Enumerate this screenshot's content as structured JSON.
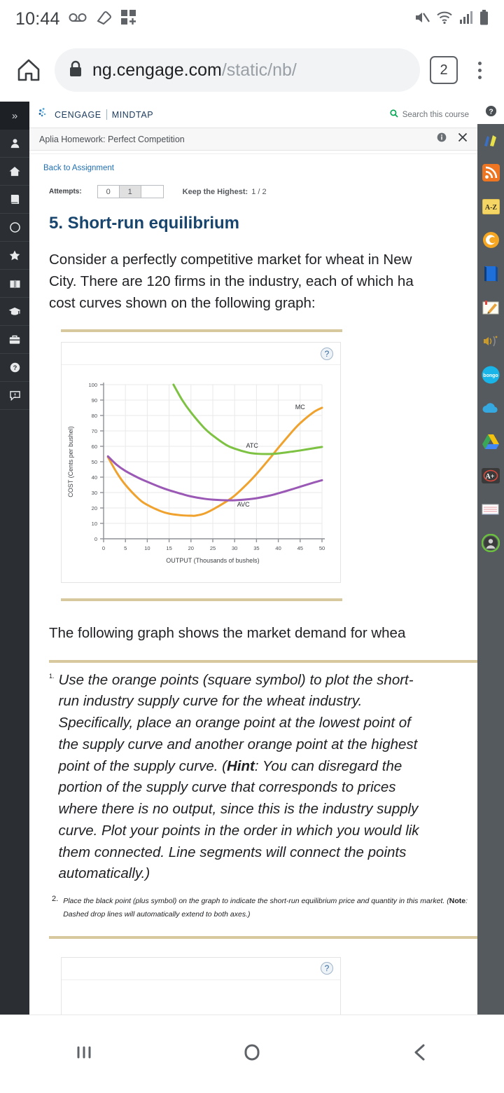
{
  "status_bar": {
    "clock": "10:44",
    "left_icons": [
      "voicemail-icon",
      "eraser-icon",
      "app-grid-plus-icon"
    ],
    "right_icons": [
      "mute-icon",
      "wifi-icon",
      "signal-icon",
      "battery-icon"
    ]
  },
  "browser": {
    "home_icon": "home-icon",
    "lock_icon": "lock-icon",
    "url_domain": "ng.cengage.com",
    "url_path": "/static/nb/",
    "tab_count": "2",
    "menu_icon": "kebab-menu-icon"
  },
  "left_rail": {
    "collapse_label": "»",
    "items": [
      {
        "name": "profile-icon"
      },
      {
        "name": "home-icon"
      },
      {
        "name": "book-icon"
      },
      {
        "name": "compass-icon"
      },
      {
        "name": "star-icon"
      },
      {
        "name": "open-book-icon"
      },
      {
        "name": "graduation-cap-icon"
      },
      {
        "name": "briefcase-icon"
      },
      {
        "name": "help-icon"
      },
      {
        "name": "feedback-icon"
      }
    ]
  },
  "right_rail": {
    "top_help_icon": "help-icon",
    "apps": [
      {
        "name": "highlighter-pen-icon"
      },
      {
        "name": "rss-feed-icon"
      },
      {
        "name": "a-z-glossary-icon"
      },
      {
        "name": "spiral-swirl-icon"
      },
      {
        "name": "blue-book-icon"
      },
      {
        "name": "notepad-pencil-icon"
      },
      {
        "name": "read-aloud-icon"
      },
      {
        "name": "bongo-icon",
        "label": "bongo"
      },
      {
        "name": "cloud-icon"
      },
      {
        "name": "google-drive-icon"
      },
      {
        "name": "grade-a-plus-icon",
        "label": "A+"
      },
      {
        "name": "flashcards-icon"
      },
      {
        "name": "user-avatar-icon"
      }
    ]
  },
  "header": {
    "brand": "CENGAGE",
    "brand_sub": "MINDTAP",
    "search_label": "Search this course",
    "search_icon": "search-icon",
    "assignment_title": "Aplia Homework: Perfect Competition",
    "info_icon": "info-icon",
    "close_icon": "close-icon"
  },
  "page": {
    "back_link": "Back to Assignment",
    "attempts_label": "Attempts:",
    "attempt_values": [
      "0",
      "1",
      ""
    ],
    "selected_attempt_index": 1,
    "keep_highest_label": "Keep the Highest:",
    "keep_highest_value": "1 / 2",
    "question_title": "5. Short-run equilibrium",
    "intro_lines": [
      "Consider a perfectly competitive market for wheat in New",
      "City. There are 120 firms in the industry, each of which ha",
      "cost curves shown on the following graph:"
    ],
    "demand_line": "The following graph shows the market demand for whea",
    "instruction_1_number": "1.",
    "instruction_1_lines": [
      "Use the orange points (square symbol) to plot the short-",
      "run industry supply curve for the wheat industry.",
      "Specifically, place an orange point at the lowest point of",
      "the supply curve and another orange point at the highest",
      "point of the supply curve. (Hint: You can disregard the",
      "portion of the supply curve that corresponds to prices",
      "where there is no output, since this is the industry supply",
      "curve. Plot your points in the order in which you would lik",
      "them connected. Line segments will connect the points",
      "automatically.)"
    ],
    "instruction_2_number": "2.",
    "instruction_2_text_a": "Place the black point (plus symbol) on the graph to indicate the short-run equilibrium price and quantity in this market. (",
    "instruction_2_note_label": "Note",
    "instruction_2_text_b": ": Dashed drop lines will automatically extend to both axes.)",
    "graph_help_icon": "help-icon",
    "bottom_panel_help_icon": "help-icon"
  },
  "colors": {
    "mc_orange": "#F0A22E",
    "atc_green": "#7DC242",
    "avc_purple": "#9B59B6",
    "title_blue": "#17456E",
    "link_blue": "#1F6FB2",
    "tan_rule": "#D8C89E",
    "left_rail": "#2B2F33",
    "right_rail": "#555A5E"
  },
  "chart_data": {
    "type": "line",
    "title": "",
    "xlabel": "OUTPUT (Thousands of bushels)",
    "ylabel": "COST (Cents per bushel)",
    "xlim": [
      0,
      50
    ],
    "ylim": [
      0,
      100
    ],
    "xticks": [
      0,
      5,
      10,
      15,
      20,
      25,
      30,
      35,
      40,
      45,
      50
    ],
    "yticks": [
      0,
      10,
      20,
      30,
      40,
      50,
      60,
      70,
      80,
      90,
      100
    ],
    "grid": true,
    "legend_position": "inline-labels",
    "series": [
      {
        "name": "MC",
        "label": "MC",
        "color": "#F0A22E",
        "label_x": 45,
        "label_y": 84,
        "x": [
          1,
          3,
          5,
          8,
          10,
          13,
          15,
          18,
          20,
          21,
          23,
          25,
          28,
          30,
          33,
          35,
          38,
          40,
          43,
          45,
          48,
          50
        ],
        "y": [
          53,
          43,
          35,
          26,
          22,
          18,
          16.3,
          15.2,
          15.0,
          15.0,
          16.3,
          19,
          24,
          28,
          36,
          42,
          52,
          59,
          69,
          75,
          82,
          85
        ]
      },
      {
        "name": "ATC",
        "label": "ATC",
        "color": "#7DC242",
        "label_x": 34,
        "label_y": 59,
        "x": [
          16,
          18,
          20,
          23,
          25,
          28,
          30,
          33,
          35,
          38,
          40,
          43,
          45,
          48,
          50
        ],
        "y": [
          100,
          90,
          82,
          72,
          67,
          61,
          58.5,
          56,
          55.2,
          55.0,
          55.4,
          56.5,
          57.3,
          58.7,
          59.6
        ]
      },
      {
        "name": "AVC",
        "label": "AVC",
        "color": "#9B59B6",
        "label_x": 32,
        "label_y": 21,
        "x": [
          1,
          3,
          5,
          8,
          10,
          13,
          15,
          18,
          20,
          23,
          25,
          28,
          30,
          33,
          35,
          38,
          40,
          43,
          45,
          48,
          50
        ],
        "y": [
          53.5,
          48,
          44,
          39.5,
          37,
          33.5,
          31.5,
          29,
          27.5,
          26,
          25.4,
          25.0,
          25.0,
          25.6,
          26.3,
          28,
          29.5,
          32,
          33.8,
          36.4,
          38
        ]
      }
    ]
  }
}
